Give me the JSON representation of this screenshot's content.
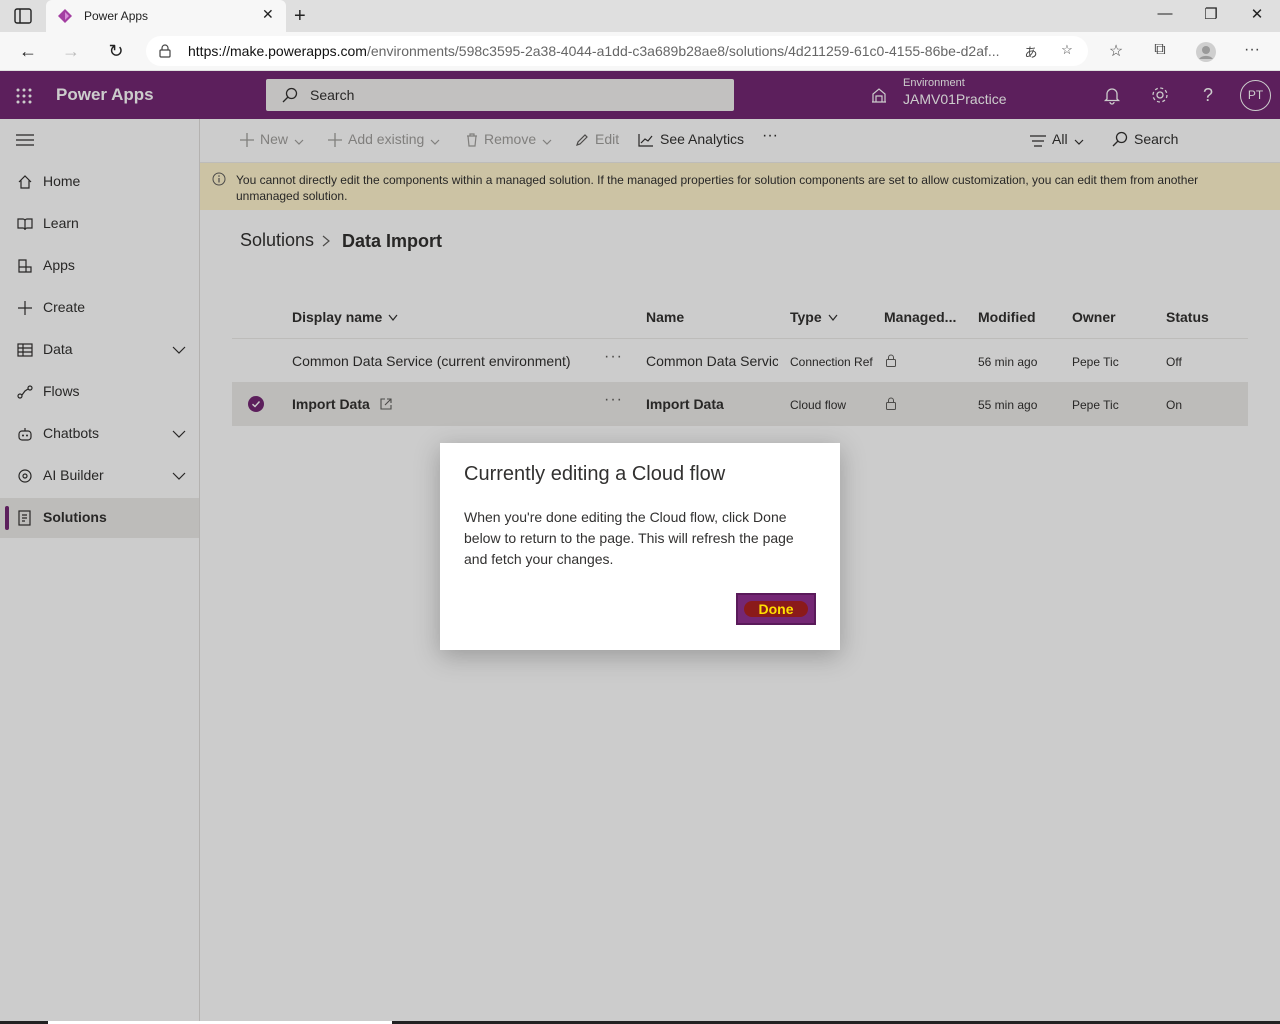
{
  "browser": {
    "tab_title": "Power Apps",
    "url_host": "https://make.powerapps.com",
    "url_path": "/environments/598c3595-2a38-4044-a1dd-c3a689b28ae8/solutions/4d211259-61c0-4155-86be-d2af..."
  },
  "header": {
    "app_name": "Power Apps",
    "search_placeholder": "Search",
    "environment_label": "Environment",
    "environment_name": "JAMV01Practice",
    "avatar_initials": "PT"
  },
  "leftnav": {
    "items": [
      {
        "label": "Home"
      },
      {
        "label": "Learn"
      },
      {
        "label": "Apps"
      },
      {
        "label": "Create"
      },
      {
        "label": "Data"
      },
      {
        "label": "Flows"
      },
      {
        "label": "Chatbots"
      },
      {
        "label": "AI Builder"
      },
      {
        "label": "Solutions"
      }
    ]
  },
  "commandbar": {
    "new": "New",
    "add_existing": "Add existing",
    "remove": "Remove",
    "edit": "Edit",
    "see_analytics": "See Analytics",
    "more": "···",
    "filter": "All",
    "search": "Search"
  },
  "banner": {
    "text": "You cannot directly edit the components within a managed solution. If the managed properties for solution components are set to allow customization, you can edit them from another unmanaged solution."
  },
  "breadcrumb": {
    "root": "Solutions",
    "current": "Data Import"
  },
  "grid": {
    "columns": [
      "Display name",
      "Name",
      "Type",
      "Managed...",
      "Modified",
      "Owner",
      "Status"
    ],
    "rows": [
      {
        "display_name": "Common Data Service (current environment)",
        "name": "Common Data Servic",
        "type": "Connection Ref",
        "modified": "56 min ago",
        "owner": "Pepe Tic",
        "status": "Off",
        "selected": false
      },
      {
        "display_name": "Import Data",
        "name": "Import Data",
        "type": "Cloud flow",
        "modified": "55 min ago",
        "owner": "Pepe Tic",
        "status": "On",
        "selected": true
      }
    ],
    "row_more": "···"
  },
  "dialog": {
    "title": "Currently editing a Cloud flow",
    "body": "When you're done editing the Cloud flow, click Done below to return to the page. This will refresh the page and fetch your changes.",
    "done_label": "Done"
  },
  "colors": {
    "brand": "#742774",
    "banner": "#fff4ce"
  }
}
